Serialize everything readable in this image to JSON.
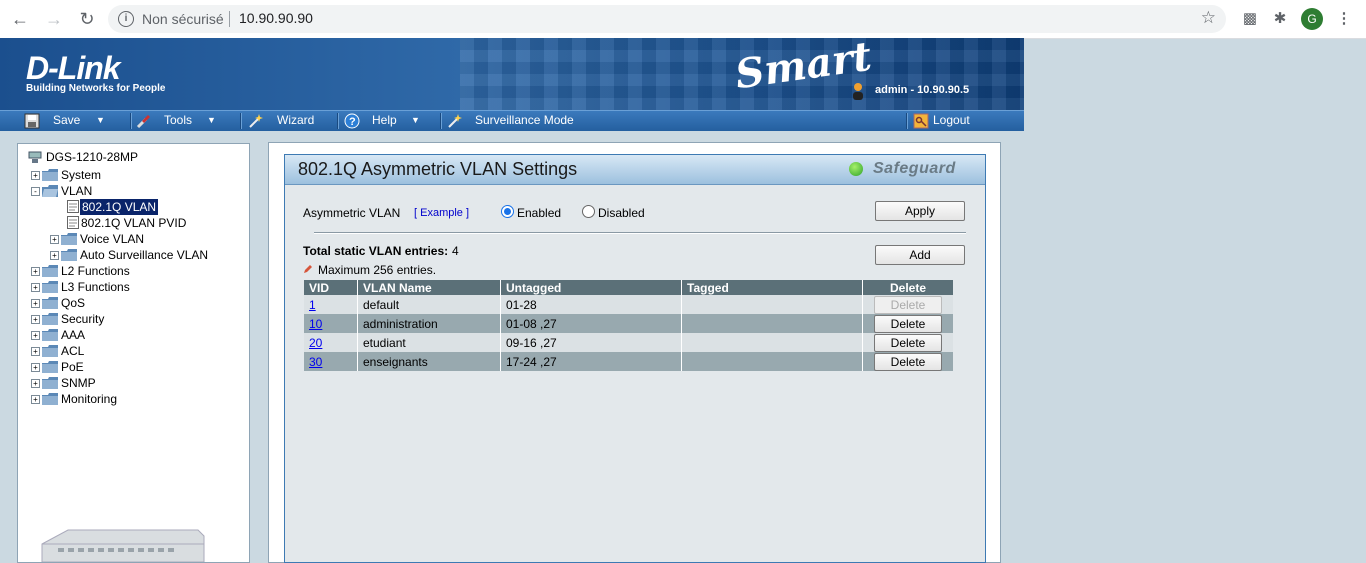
{
  "browser": {
    "security_label": "Non sécurisé",
    "url": "10.90.90.90",
    "avatar_letter": "G"
  },
  "header": {
    "brand": "D-Link",
    "slogan": "Building Networks for People",
    "product": "Smart",
    "admin": "admin - 10.90.90.5"
  },
  "menu": {
    "save": "Save",
    "tools": "Tools",
    "wizard": "Wizard",
    "help": "Help",
    "surveillance": "Surveillance Mode",
    "logout": "Logout"
  },
  "tree": {
    "root": "DGS-1210-28MP",
    "items": [
      {
        "label": "System"
      },
      {
        "label": "VLAN"
      },
      {
        "label": "802.1Q VLAN"
      },
      {
        "label": "802.1Q VLAN PVID"
      },
      {
        "label": "Voice VLAN"
      },
      {
        "label": "Auto Surveillance VLAN"
      },
      {
        "label": "L2 Functions"
      },
      {
        "label": "L3 Functions"
      },
      {
        "label": "QoS"
      },
      {
        "label": "Security"
      },
      {
        "label": "AAA"
      },
      {
        "label": "ACL"
      },
      {
        "label": "PoE"
      },
      {
        "label": "SNMP"
      },
      {
        "label": "Monitoring"
      }
    ]
  },
  "page": {
    "title": "802.1Q Asymmetric VLAN Settings",
    "safeguard": "Safeguard",
    "asym_label": "Asymmetric VLAN",
    "example": "[ Example ]",
    "enabled": "Enabled",
    "disabled": "Disabled",
    "asym_state": "enabled",
    "apply": "Apply",
    "total_label": "Total static VLAN entries:",
    "total_value": "4",
    "max_entries": "Maximum 256 entries.",
    "add": "Add"
  },
  "table": {
    "headers": [
      "VID",
      "VLAN Name",
      "Untagged",
      "Tagged",
      "Delete"
    ],
    "rows": [
      {
        "vid": "1",
        "name": "default",
        "untagged": "01-28",
        "tagged": "",
        "delete": "Delete",
        "delete_enabled": false
      },
      {
        "vid": "10",
        "name": "administration",
        "untagged": "01-08 ,27",
        "tagged": "",
        "delete": "Delete",
        "delete_enabled": true
      },
      {
        "vid": "20",
        "name": "etudiant",
        "untagged": "09-16 ,27",
        "tagged": "",
        "delete": "Delete",
        "delete_enabled": true
      },
      {
        "vid": "30",
        "name": "enseignants",
        "untagged": "17-24 ,27",
        "tagged": "",
        "delete": "Delete",
        "delete_enabled": true
      }
    ]
  }
}
